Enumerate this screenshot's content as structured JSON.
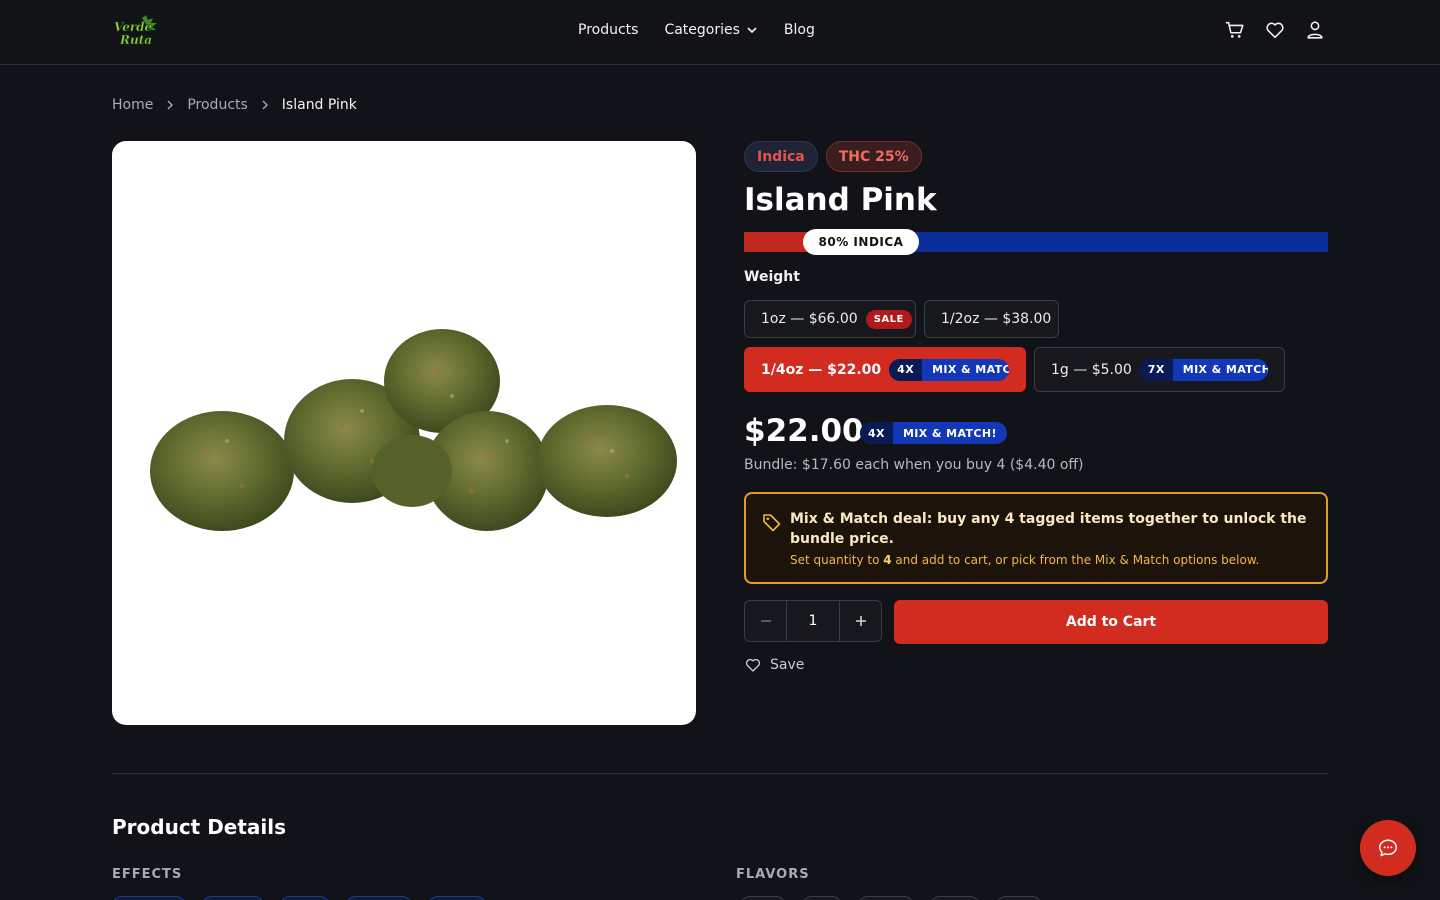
{
  "header": {
    "logo_text": "Verde Ruta",
    "nav": [
      {
        "label": "Products"
      },
      {
        "label": "Categories",
        "has_dropdown": true
      },
      {
        "label": "Blog"
      }
    ],
    "icons": [
      "cart-icon",
      "heart-icon",
      "user-icon"
    ]
  },
  "breadcrumb": [
    "Home",
    "Products",
    "Island Pink"
  ],
  "product": {
    "badges": {
      "type": "Indica",
      "thc": "THC 25%"
    },
    "title": "Island Pink",
    "ratio": {
      "label": "80% INDICA",
      "indica_fraction": 0.8
    },
    "weight_label": "Weight",
    "options": [
      {
        "label": "1oz — $66.00",
        "tag": "SALE"
      },
      {
        "label": "1/2oz — $38.00"
      },
      {
        "label": "1/4oz — $22.00",
        "mm_count": "4X",
        "mm_text": "MIX & MATCH!",
        "selected": true
      },
      {
        "label": "1g — $5.00",
        "mm_count": "7X",
        "mm_text": "MIX & MATCH!"
      }
    ],
    "price": "$22.00",
    "price_tag": {
      "count": "4X",
      "text": "MIX & MATCH!"
    },
    "bundle_note": "Bundle: $17.60 each when you buy 4 ($4.40 off)",
    "deal": {
      "title": "Mix & Match deal: buy any 4 tagged items together to unlock the bundle price.",
      "sub_before": "Set quantity to ",
      "sub_qty": "4",
      "sub_after": " and add to cart, or pick from the Mix & Match options below."
    },
    "quantity": "1",
    "add_to_cart": "Add to Cart",
    "save_label": "Save"
  },
  "details": {
    "title": "Product Details",
    "effects_label": "EFFECTS",
    "flavors_label": "FLAVORS"
  },
  "colors": {
    "accent_red": "#d22b1f",
    "indica_blue": "#0d2e9a",
    "deal_border": "#e49b2b",
    "background": "#111318"
  }
}
